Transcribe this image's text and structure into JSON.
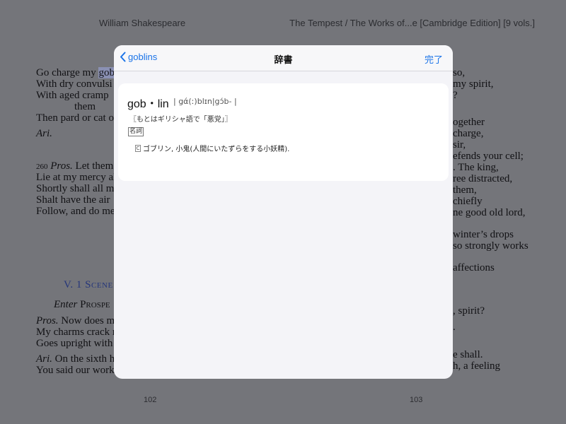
{
  "book": {
    "header_left": "William Shakespeare",
    "header_right": "The Tempest / The Works of...e [Cambridge Edition] [9 vols.]",
    "left_page": {
      "lines": [
        {
          "pre": "Go charge my ",
          "hl": "gob",
          "post": ""
        },
        {
          "text": "With dry convulsi"
        },
        {
          "text": "With  aged  cramp"
        },
        {
          "text": "them"
        },
        {
          "text": "Then pard or cat o"
        },
        {
          "text": "Ari."
        },
        {
          "num": "260",
          "speaker": "Pros.",
          "text": " Let them"
        },
        {
          "text": "Lie at my mercy al"
        },
        {
          "text": "Shortly shall all m"
        },
        {
          "text": "Shalt have the air"
        },
        {
          "text": "Follow, and do me"
        },
        {
          "text": "V. 1 Scene"
        },
        {
          "speaker": "Enter",
          "text": " Prospe"
        },
        {
          "speaker": "Pros.",
          "text": " Now does my"
        },
        {
          "text": "My charms crack n"
        },
        {
          "text": "Goes upright with"
        },
        {
          "speaker": "Ari.",
          "text": " On the sixth h"
        },
        {
          "text": "You said our work"
        }
      ],
      "page_number": "102"
    },
    "right_page": {
      "lines": [
        "so,",
        "my spirit,",
        "?",
        "ogether",
        "charge,",
        "sir,",
        "efends your cell;",
        ". The king,",
        "ree distracted,",
        "them,",
        "chiefly",
        "ne  good  old  lord,",
        "winter’s drops",
        "so strongly works",
        "affections",
        ", spirit?",
        ".",
        "e shall.",
        "h, a feeling"
      ],
      "page_number": "103"
    }
  },
  "dictionary": {
    "back_label": "goblins",
    "title": "辞書",
    "done_label": "完了",
    "headword": "gob・lin",
    "pronunciation": "| gά(ː)blɪn|gɔ́b- |",
    "etymology": "〖もとはギリシャ語で「悪党」〗",
    "part_of_speech": "名詞",
    "sense_mark": "C",
    "sense": "ゴブリン, 小鬼(人間にいたずらをする小妖精)."
  }
}
